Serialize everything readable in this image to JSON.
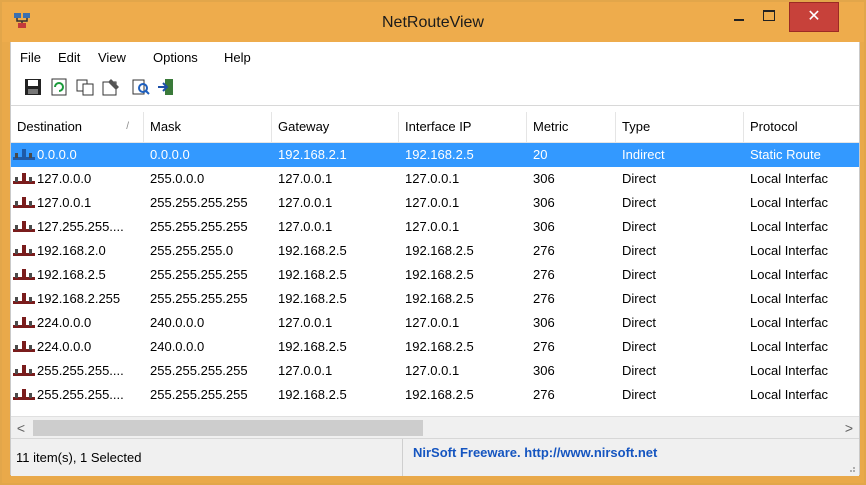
{
  "window": {
    "title": "NetRouteView"
  },
  "menu": [
    "File",
    "Edit",
    "View",
    "Options",
    "Help"
  ],
  "toolbar_icons": [
    "save-icon",
    "refresh-icon",
    "copy-icon",
    "properties-icon",
    "find-icon",
    "exit-icon"
  ],
  "columns": [
    "Destination",
    "Mask",
    "Gateway",
    "Interface IP",
    "Metric",
    "Type",
    "Protocol"
  ],
  "rows": [
    [
      "0.0.0.0",
      "0.0.0.0",
      "192.168.2.1",
      "192.168.2.5",
      "20",
      "Indirect",
      "Static Route"
    ],
    [
      "127.0.0.0",
      "255.0.0.0",
      "127.0.0.1",
      "127.0.0.1",
      "306",
      "Direct",
      "Local Interfac"
    ],
    [
      "127.0.0.1",
      "255.255.255.255",
      "127.0.0.1",
      "127.0.0.1",
      "306",
      "Direct",
      "Local Interfac"
    ],
    [
      "127.255.255....",
      "255.255.255.255",
      "127.0.0.1",
      "127.0.0.1",
      "306",
      "Direct",
      "Local Interfac"
    ],
    [
      "192.168.2.0",
      "255.255.255.0",
      "192.168.2.5",
      "192.168.2.5",
      "276",
      "Direct",
      "Local Interfac"
    ],
    [
      "192.168.2.5",
      "255.255.255.255",
      "192.168.2.5",
      "192.168.2.5",
      "276",
      "Direct",
      "Local Interfac"
    ],
    [
      "192.168.2.255",
      "255.255.255.255",
      "192.168.2.5",
      "192.168.2.5",
      "276",
      "Direct",
      "Local Interfac"
    ],
    [
      "224.0.0.0",
      "240.0.0.0",
      "127.0.0.1",
      "127.0.0.1",
      "306",
      "Direct",
      "Local Interfac"
    ],
    [
      "224.0.0.0",
      "240.0.0.0",
      "192.168.2.5",
      "192.168.2.5",
      "276",
      "Direct",
      "Local Interfac"
    ],
    [
      "255.255.255....",
      "255.255.255.255",
      "127.0.0.1",
      "127.0.0.1",
      "306",
      "Direct",
      "Local Interfac"
    ],
    [
      "255.255.255....",
      "255.255.255.255",
      "192.168.2.5",
      "192.168.2.5",
      "276",
      "Direct",
      "Local Interfac"
    ]
  ],
  "selected_row": 0,
  "status": {
    "items": "11 item(s), 1 Selected",
    "credit": "NirSoft Freeware.  http://www.nirsoft.net"
  },
  "colors": {
    "title_bar": "#eeac4c",
    "selection": "#3399ff",
    "close_button": "#c7413a",
    "link": "#1555c0"
  }
}
